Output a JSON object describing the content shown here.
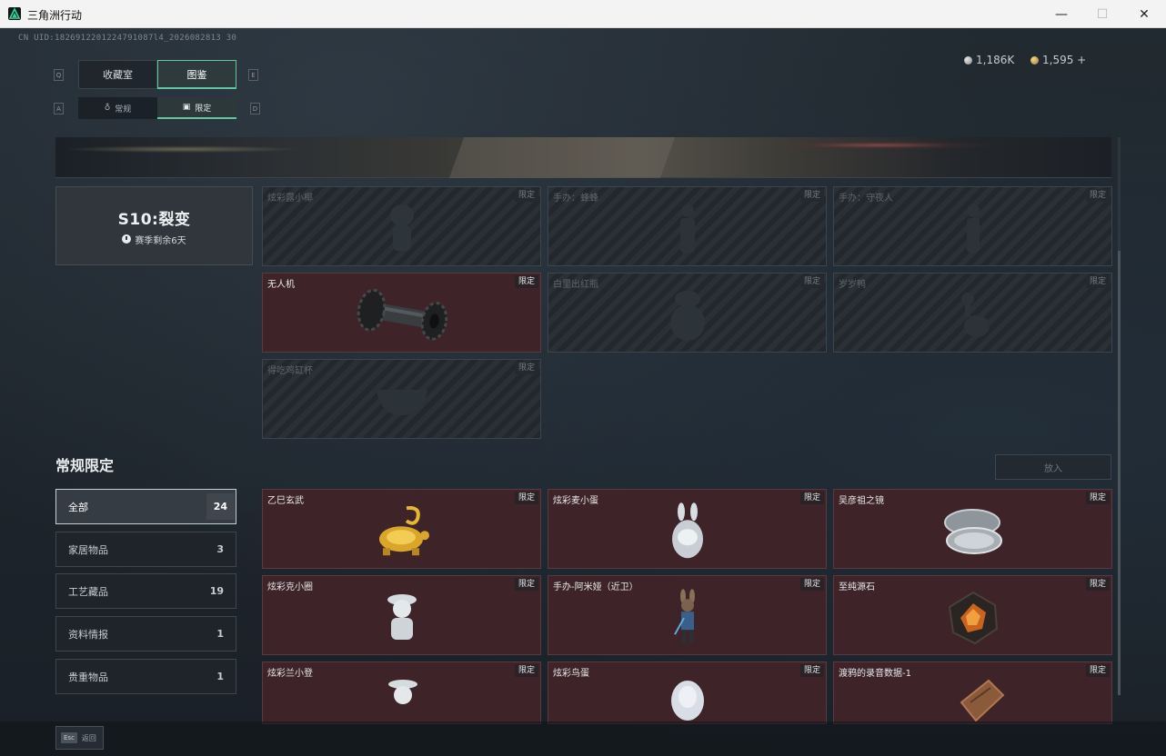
{
  "window": {
    "title": "三角洲行动",
    "minimize": "—",
    "maximize": "☐",
    "close": "✕"
  },
  "header": {
    "uid": "CN UID:1826912201224791087l4_2026082813 30",
    "currencies": [
      {
        "value": "1,186K"
      },
      {
        "value": "1,595 +"
      }
    ]
  },
  "tabs": {
    "main": [
      {
        "label": "收藏室",
        "key": "Q",
        "active": false
      },
      {
        "label": "图鉴",
        "key": "E",
        "active": true
      }
    ],
    "sub": [
      {
        "label": "常规",
        "key": "A",
        "active": false
      },
      {
        "label": "限定",
        "key": "D",
        "active": true
      }
    ]
  },
  "season": {
    "title": "S10:裂变",
    "remaining": "赛季剩余6天"
  },
  "limited_items": [
    {
      "name": "炫彩露小椰",
      "tag": "限定",
      "owned": false
    },
    {
      "name": "手办：蜂蜂",
      "tag": "限定",
      "owned": false
    },
    {
      "name": "手办：守夜人",
      "tag": "限定",
      "owned": false
    },
    {
      "name": "无人机",
      "tag": "限定",
      "owned": true
    },
    {
      "name": "白里出红瓶",
      "tag": "限定",
      "owned": false
    },
    {
      "name": "岁岁鸭",
      "tag": "限定",
      "owned": false
    },
    {
      "name": "得吃鸡缸杯",
      "tag": "限定",
      "owned": false
    }
  ],
  "regular": {
    "section_title": "常规限定",
    "put_in_label": "放入",
    "categories": [
      {
        "label": "全部",
        "count": "24",
        "active": true
      },
      {
        "label": "家居物品",
        "count": "3",
        "active": false
      },
      {
        "label": "工艺藏品",
        "count": "19",
        "active": false
      },
      {
        "label": "资料情报",
        "count": "1",
        "active": false
      },
      {
        "label": "贵重物品",
        "count": "1",
        "active": false
      }
    ],
    "items": [
      {
        "name": "乙巳玄武",
        "tag": "限定"
      },
      {
        "name": "炫彩麦小蛋",
        "tag": "限定"
      },
      {
        "name": "吴彦祖之镜",
        "tag": "限定"
      },
      {
        "name": "炫彩克小圈",
        "tag": "限定"
      },
      {
        "name": "手办-阿米娅（近卫）",
        "tag": "限定"
      },
      {
        "name": "至纯源石",
        "tag": "限定"
      },
      {
        "name": "炫彩兰小登",
        "tag": "限定"
      },
      {
        "name": "炫彩鸟蛋",
        "tag": "限定"
      },
      {
        "name": "渡鸦的录音数据-1",
        "tag": "限定"
      }
    ]
  },
  "footer": {
    "esc_key": "Esc",
    "esc_label": "返回"
  },
  "colors": {
    "accent": "#5fc79e",
    "owned_card": "#3e2328",
    "background": "#1e242b"
  }
}
